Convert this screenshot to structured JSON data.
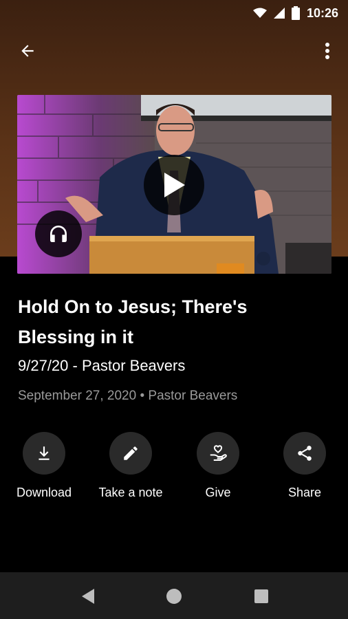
{
  "status_bar": {
    "time": "10:26"
  },
  "app_bar": {
    "back_icon": "arrow-back-icon",
    "menu_icon": "more-vert-icon"
  },
  "video": {
    "thumbnail": "pastor-preaching-at-podium",
    "play_icon": "play-icon",
    "audio_icon": "headphones-icon"
  },
  "sermon": {
    "title": "Hold On to Jesus; There's Blessing in it",
    "subtitle": "9/27/20 - Pastor Beavers",
    "date": "September 27, 2020",
    "separator": "•",
    "speaker": "Pastor Beavers"
  },
  "actions": [
    {
      "label": "Download",
      "icon": "download-icon"
    },
    {
      "label": "Take a note",
      "icon": "pencil-icon"
    },
    {
      "label": "Give",
      "icon": "give-hand-heart-icon"
    },
    {
      "label": "Share",
      "icon": "share-icon"
    }
  ],
  "colors": {
    "header_brown": "#5a3217",
    "background": "#000000",
    "button_circle": "#2a2a2a",
    "meta_gray": "#9a9a9a"
  }
}
